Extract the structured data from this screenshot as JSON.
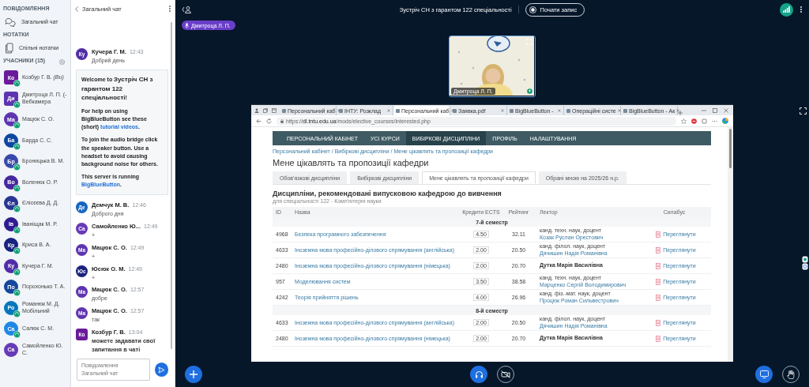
{
  "sidebar": {
    "messages_heading": "ПОВІДОМЛЕННЯ",
    "public_chat": "Загальний чат",
    "notes_heading": "НОТАТКИ",
    "shared_notes": "Спільні нотатки",
    "users_heading": "УЧАСНИКИ (15)",
    "users": [
      {
        "initials": "Ко",
        "name": "Козбур Г. В. *(Ви)*",
        "moderator": true,
        "audio": true,
        "color": "#6a1b9a"
      },
      {
        "initials": "Ди",
        "name": "Дмитроца Л. П. (-Вебкамера",
        "moderator": true,
        "audio": true,
        "color": "#5e35b1"
      },
      {
        "initials": "Ма",
        "name": "Мацюк С. О.",
        "moderator": false,
        "audio": true,
        "color": "#5e35b1"
      },
      {
        "initials": "Ба",
        "name": "Барда С. С.",
        "moderator": false,
        "audio": true,
        "color": "#0d47a1"
      },
      {
        "initials": "Бр",
        "name": "Броницька В. М.",
        "moderator": false,
        "audio": true,
        "color": "#3949ab"
      },
      {
        "initials": "Во",
        "name": "Воленюк О. Р.",
        "moderator": false,
        "audio": true,
        "color": "#4527a0"
      },
      {
        "initials": "Єл",
        "name": "Єлісєєва Д. Д.",
        "moderator": false,
        "audio": true,
        "color": "#283593"
      },
      {
        "initials": "Ів",
        "name": "Іваніщак М. Р.",
        "moderator": false,
        "audio": true,
        "color": "#311b92"
      },
      {
        "initials": "Кр",
        "name": "Криса В. А.",
        "moderator": false,
        "audio": true,
        "color": "#1a237e"
      },
      {
        "initials": "Ку",
        "name": "Кучера Г. М.",
        "moderator": false,
        "audio": true,
        "color": "#512da8"
      },
      {
        "initials": "По",
        "name": "Порохонько Т. А.",
        "moderator": false,
        "audio": true,
        "color": "#1546a0"
      },
      {
        "initials": "Ро",
        "name": "Романюк М. Д. Мобільний",
        "moderator": false,
        "audio": true,
        "color": "#0277bd"
      },
      {
        "initials": "Са",
        "name": "Салюк С. М.",
        "moderator": false,
        "audio": true,
        "color": "#1e88e5"
      },
      {
        "initials": "Са",
        "name": "Самойленко Ю. С.",
        "moderator": false,
        "audio": false,
        "color": "#673ab7"
      }
    ]
  },
  "chat": {
    "title": "Загальний чат",
    "messages": [
      {
        "kind": "message",
        "initials": "Ку",
        "name": "Кучера Г. М.",
        "time": "12:43",
        "text": "Добрий день",
        "moderator": false,
        "color": "#512da8"
      },
      {
        "kind": "welcome",
        "paragraphs": [
          [
            {
              "text": "Welcome to **Зустріч СН з гарантом 122 спеціальності**!"
            }
          ],
          [
            {
              "text": "For help on using BigBlueButton see these (short) "
            },
            {
              "link": "tutorial videos"
            },
            {
              "text": "."
            }
          ],
          [
            {
              "text": "To join the audio bridge click the speaker button. Use a headset to avoid causing background noise for others."
            }
          ],
          [
            {
              "text": "This server is running "
            },
            {
              "link": "BigBlueButton"
            },
            {
              "text": "."
            }
          ]
        ]
      },
      {
        "kind": "message",
        "initials": "Де",
        "name": "Демчук М. В.",
        "time": "12:46",
        "text": "Доброго дня",
        "moderator": false,
        "color": "#1565c0"
      },
      {
        "kind": "message",
        "initials": "Са",
        "name": "Самойленко Ю...",
        "time": "12:49",
        "text": "+",
        "moderator": false,
        "color": "#673ab7"
      },
      {
        "kind": "message",
        "initials": "Ма",
        "name": "Мацюк С. О.",
        "time": "12:49",
        "text": "+",
        "moderator": false,
        "color": "#5e35b1"
      },
      {
        "kind": "message",
        "initials": "Юс",
        "name": "Юсюк О. М.",
        "time": "12:49",
        "text": "+",
        "moderator": false,
        "color": "#1a237e"
      },
      {
        "kind": "message",
        "initials": "Ма",
        "name": "Мацюк С. О.",
        "time": "12:57",
        "text": "добре",
        "moderator": false,
        "color": "#5e35b1"
      },
      {
        "kind": "message",
        "initials": "Ма",
        "name": "Мацюк С. О.",
        "time": "12:57",
        "text": "так",
        "moderator": false,
        "color": "#5e35b1"
      },
      {
        "kind": "message",
        "initials": "Ко",
        "name": "Козбур Г. В.",
        "time": "13:04",
        "text": "можете задавати свої запитання в чаті",
        "moderator": true,
        "color": "#6a1b9a"
      }
    ],
    "input": {
      "placeholder": "Повідомлення Загальний чат"
    }
  },
  "topbar": {
    "title": "Зустріч СН з гарантом 122 спеціальності",
    "record_button": "Почати запис"
  },
  "talker": "Дмитроца Л. П.",
  "webcam": {
    "name": "Дмитроца Л. П."
  },
  "browser": {
    "tabs": [
      {
        "title": "Персональний каб",
        "selected": false
      },
      {
        "title": "ІНТУ: Розклад",
        "selected": false
      },
      {
        "title": "Персональний каб",
        "selected": true
      },
      {
        "title": "Заявка.pdf",
        "selected": false
      },
      {
        "title": "BigBlueButton -",
        "selected": false
      },
      {
        "title": "Операційні систе",
        "selected": false
      },
      {
        "title": "BigBlueButton - Ак",
        "selected": false
      }
    ],
    "url": "https://**dl.tntu.edu.ua**/mods/elective_courses/interested.php",
    "nav": [
      {
        "label": "ПЕРСОНАЛЬНИЙ КАБІНЕТ",
        "selected": false
      },
      {
        "label": "УСІ КУРСИ",
        "selected": false
      },
      {
        "label": "ВИБІРКОВІ ДИСЦИПЛІНИ",
        "selected": true
      },
      {
        "label": "ПРОФІЛЬ",
        "selected": false
      },
      {
        "label": "НАЛАШТУВАННЯ",
        "selected": false
      }
    ],
    "breadcrumb": "Персональний кабінет / Вибіркові дисципліни / Мене цікавлять та пропозиції кафедри",
    "title": "Мене цікавлять та пропозиції кафедри",
    "page_tabs": [
      {
        "label": "Обов'язкові дисципліни",
        "selected": false
      },
      {
        "label": "Вибіркові дисципліни",
        "selected": false
      },
      {
        "label": "Мене цікавлять та пропозиції кафедри",
        "selected": true
      },
      {
        "label": "Обрані мною на 2025/26 н.р.",
        "selected": false
      }
    ],
    "section_title": "Дисципліни, рекомендовані випусковою кафедрою до вивчення",
    "section_subtitle": "для спеціальності 122 - Комп'ютерні науки",
    "table": {
      "columns": [
        "ID",
        "Назва",
        "Кредити ECTS",
        "Рейтинг",
        "Лектор",
        "Силабус"
      ],
      "groups": [
        {
          "title": "7-й семестр",
          "rows": [
            {
              "id": "4968",
              "name": "Безпека програмного забезпечення",
              "credits": "4.50",
              "rating": "32.11",
              "lecturer_title": "канд. техн. наук, доцент",
              "lecturer": "Козак Руслан Орестович",
              "syllabus": "Переглянути"
            },
            {
              "id": "4633",
              "name": "Іноземна мова професійно-ділового спрямування (англійська)",
              "credits": "2.00",
              "rating": "20.50",
              "lecturer_title": "канд. філол. наук, доцент",
              "lecturer": "Дячишин Надія Романівна",
              "syllabus": "Переглянути"
            },
            {
              "id": "2480",
              "name": "Іноземна мова професійно-ділового спрямування (німецька)",
              "credits": "2.00",
              "rating": "20.70",
              "lecturer": "Дутка Марія Василівна",
              "syllabus": "Переглянути"
            },
            {
              "id": "957",
              "name": "Моделювання систем",
              "credits": "3.50",
              "rating": "38.58",
              "lecturer_title": "канд. техн. наук, доцент",
              "lecturer": "Марценко Сергій Володимирович",
              "syllabus": "Переглянути"
            },
            {
              "id": "4242",
              "name": "Теорія прийняття рішень",
              "credits": "4.00",
              "rating": "26.96",
              "lecturer_title": "канд. фіз.-мат. наук, доцент",
              "lecturer": "Процюк Роман Сильвестрович",
              "syllabus": "Переглянути"
            }
          ]
        },
        {
          "title": "8-й семестр",
          "rows": [
            {
              "id": "4633",
              "name": "Іноземна мова професійно-ділового спрямування (англійська)",
              "credits": "2.00",
              "rating": "20.50",
              "lecturer_title": "канд. філол. наук, доцент",
              "lecturer": "Дячишин Надія Романівна",
              "syllabus": "Переглянути"
            },
            {
              "id": "2480",
              "name": "Іноземна мова професійно-ділового спрямування (німецька)",
              "credits": "2.00",
              "rating": "20.70",
              "lecturer": "Дутка Марія Василівна",
              "syllabus": "Переглянути"
            }
          ]
        }
      ]
    }
  }
}
